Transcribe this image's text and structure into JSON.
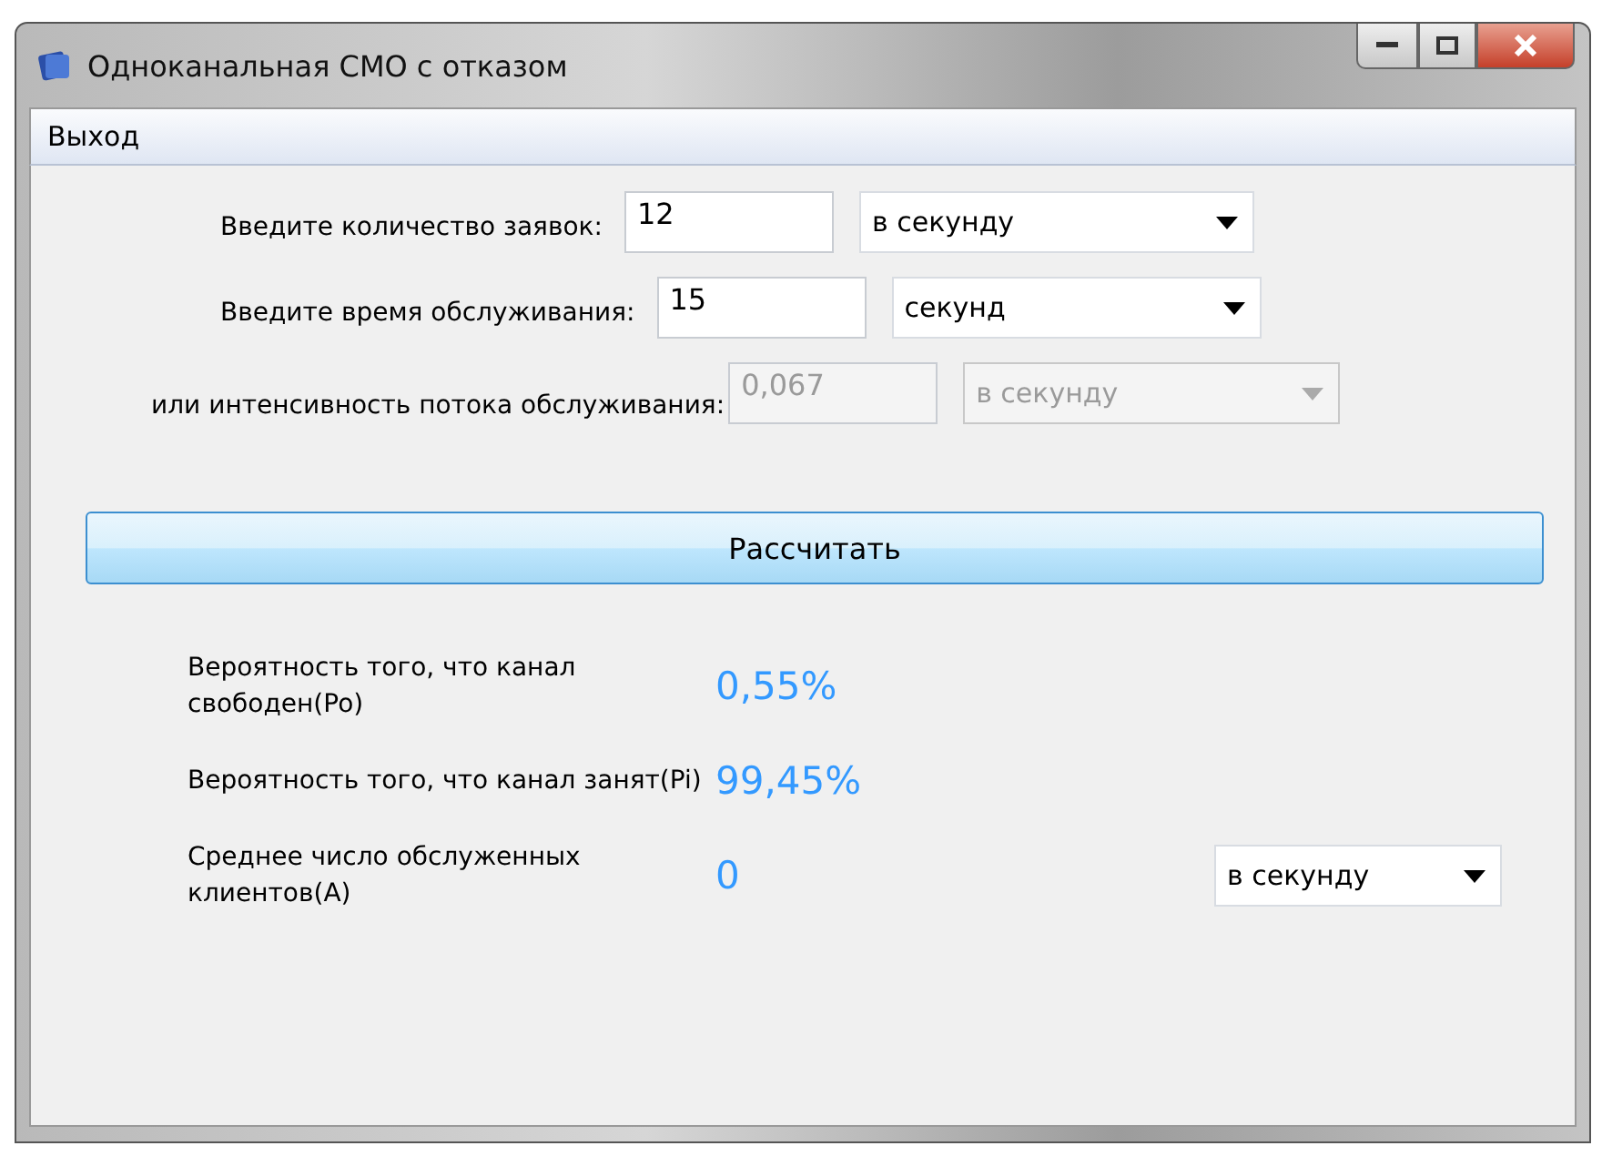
{
  "window": {
    "title": "Одноканальная СМО с отказом"
  },
  "menu": [
    {
      "label": "Выход"
    }
  ],
  "inputs": [
    {
      "label": "Введите количество заявок:",
      "value": "12",
      "unit": "в секунду",
      "disabled": false
    },
    {
      "label": "Введите время обслуживания:",
      "value": "15",
      "unit": "секунд",
      "disabled": false
    },
    {
      "label": "или интенсивность потока обслуживания:",
      "value": "0,067",
      "unit": "в секунду",
      "disabled": true
    }
  ],
  "calculate_button": "Рассчитать",
  "results": [
    {
      "label": "Вероятность того, что канал свободен(Po)",
      "value": "0,55%"
    },
    {
      "label": "Вероятность того, что канал занят(Pi)",
      "value": "99,45%"
    },
    {
      "label": "Среднее число обслуженных клиентов(A)",
      "value": "0",
      "unit": "в секунду"
    }
  ]
}
